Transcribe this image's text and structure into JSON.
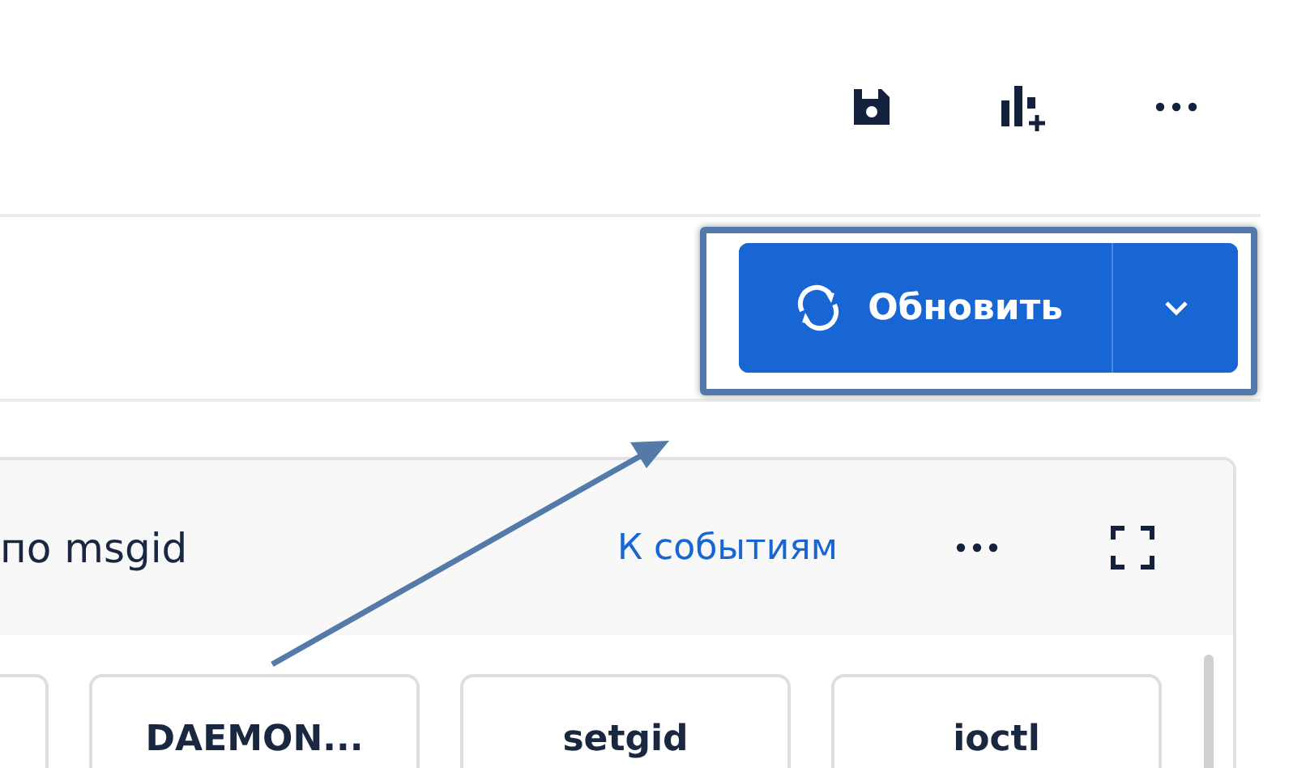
{
  "toolbar": {
    "icons": [
      {
        "kind": "save"
      },
      {
        "kind": "add-chart"
      },
      {
        "kind": "more"
      }
    ]
  },
  "refresh_button": {
    "label": "Обновить",
    "highlighted": true
  },
  "panel": {
    "title": "по msgid",
    "link": "К событиям",
    "cards": [
      {
        "label": "DAEMON..."
      },
      {
        "label": "setgid"
      },
      {
        "label": "ioctl"
      }
    ]
  },
  "annotation": {
    "arrow": true
  }
}
